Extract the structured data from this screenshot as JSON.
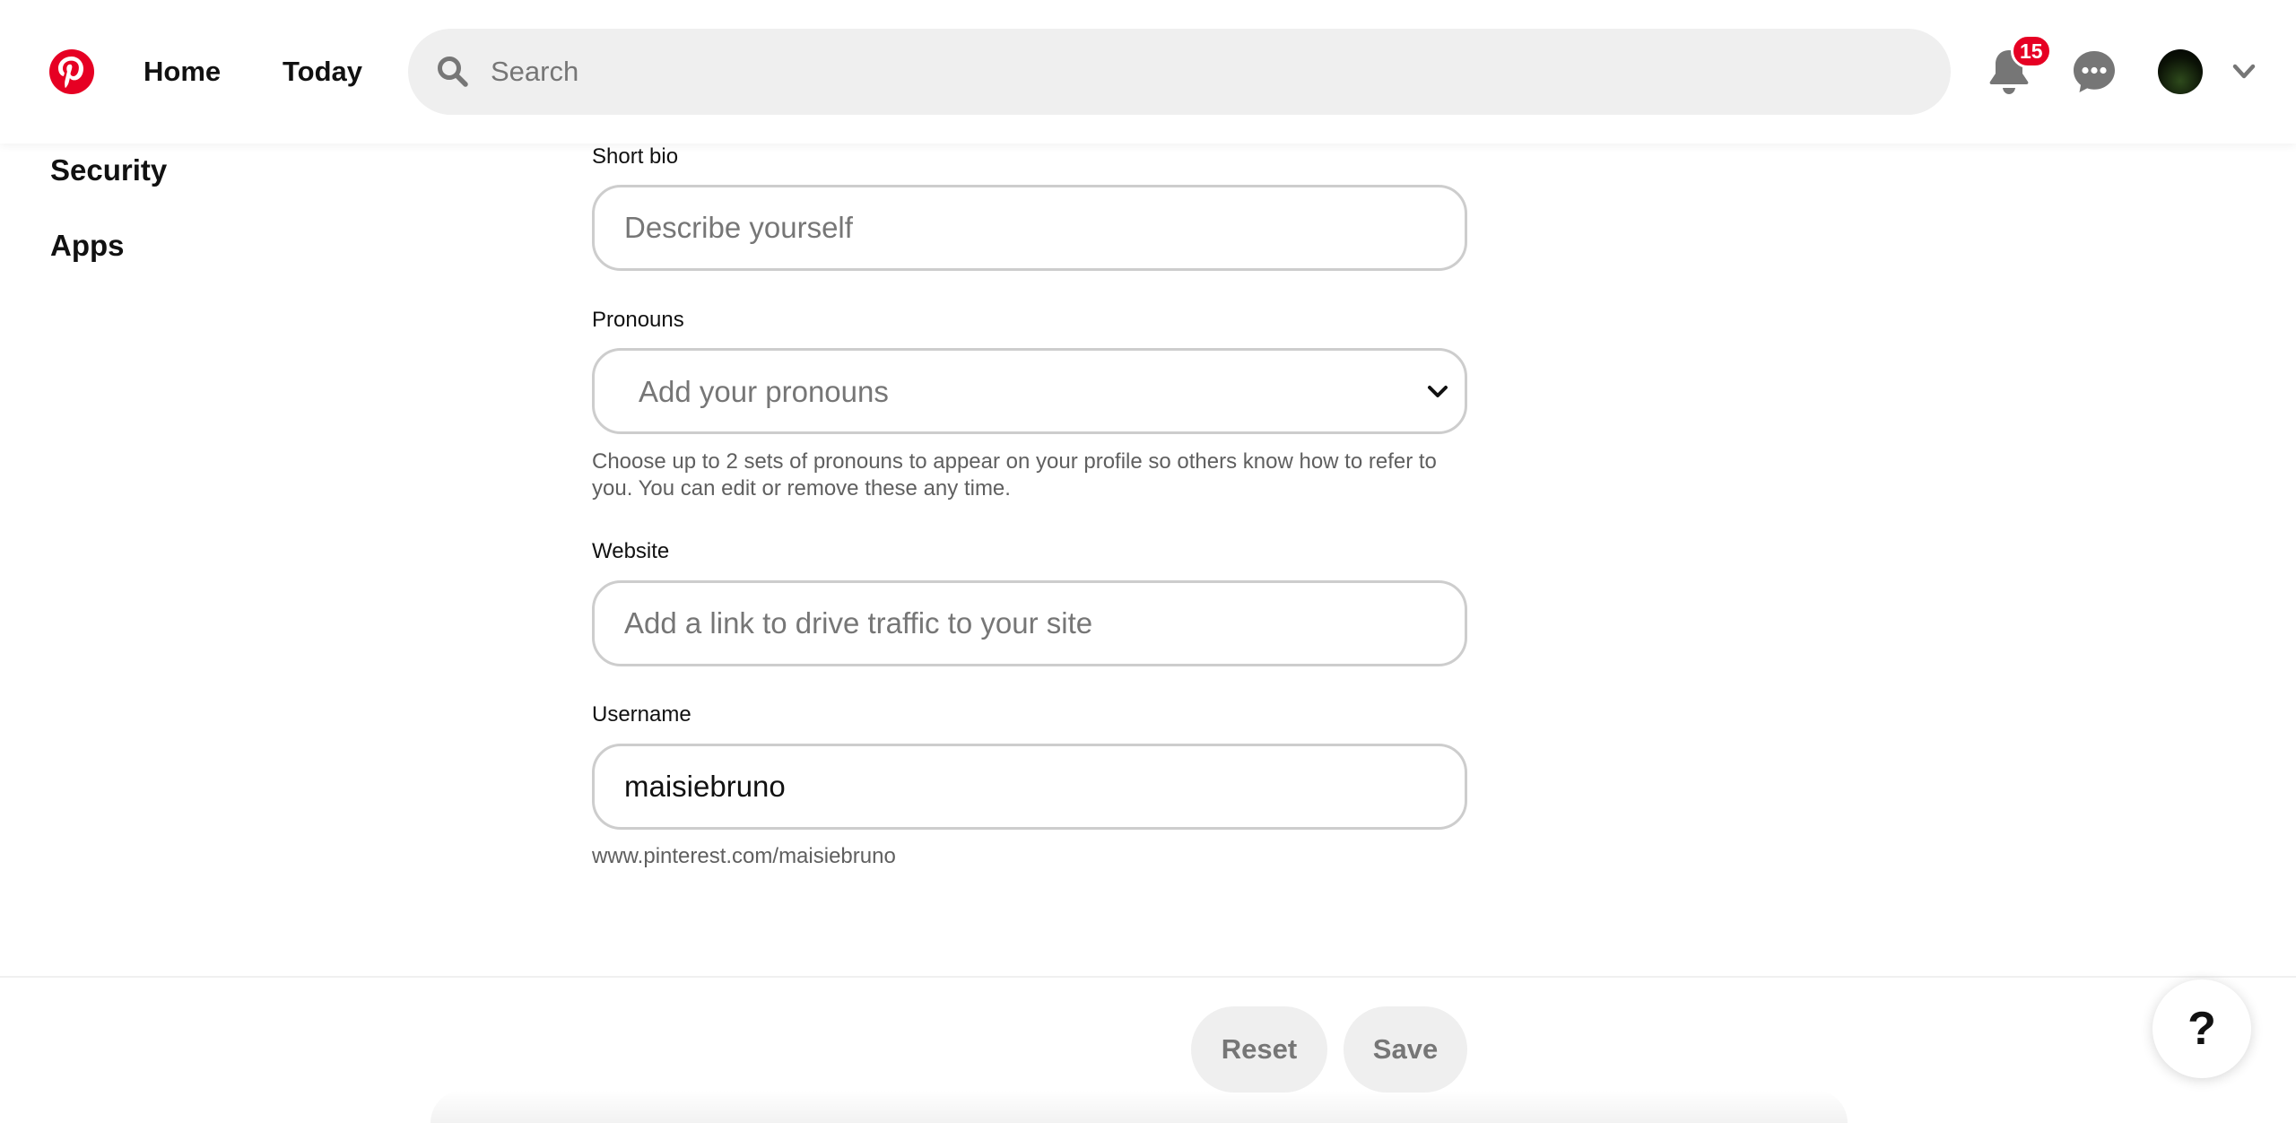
{
  "header": {
    "nav": {
      "home": "Home",
      "today": "Today"
    },
    "search": {
      "placeholder": "Search",
      "value": ""
    },
    "notifications_count": "15",
    "brand_color": "#e60023"
  },
  "sidebar": {
    "items": [
      {
        "label": "Security"
      },
      {
        "label": "Apps"
      }
    ]
  },
  "form": {
    "short_bio": {
      "label": "Short bio",
      "placeholder": "Describe yourself",
      "value": ""
    },
    "pronouns": {
      "label": "Pronouns",
      "placeholder": "Add your pronouns",
      "helper": "Choose up to 2 sets of pronouns to appear on your profile so others know how to refer to you. You can edit or remove these any time."
    },
    "website": {
      "label": "Website",
      "placeholder": "Add a link to drive traffic to your site",
      "value": ""
    },
    "username": {
      "label": "Username",
      "value": "maisiebruno",
      "profile_url": "www.pinterest.com/maisiebruno"
    }
  },
  "footer": {
    "reset_label": "Reset",
    "save_label": "Save",
    "help_label": "?"
  },
  "icons": {
    "logo": "pinterest-logo-icon",
    "search": "search-icon",
    "notifications": "bell-icon",
    "messages": "chat-bubble-icon",
    "account_menu": "chevron-down-icon",
    "select": "chevron-down-icon"
  }
}
